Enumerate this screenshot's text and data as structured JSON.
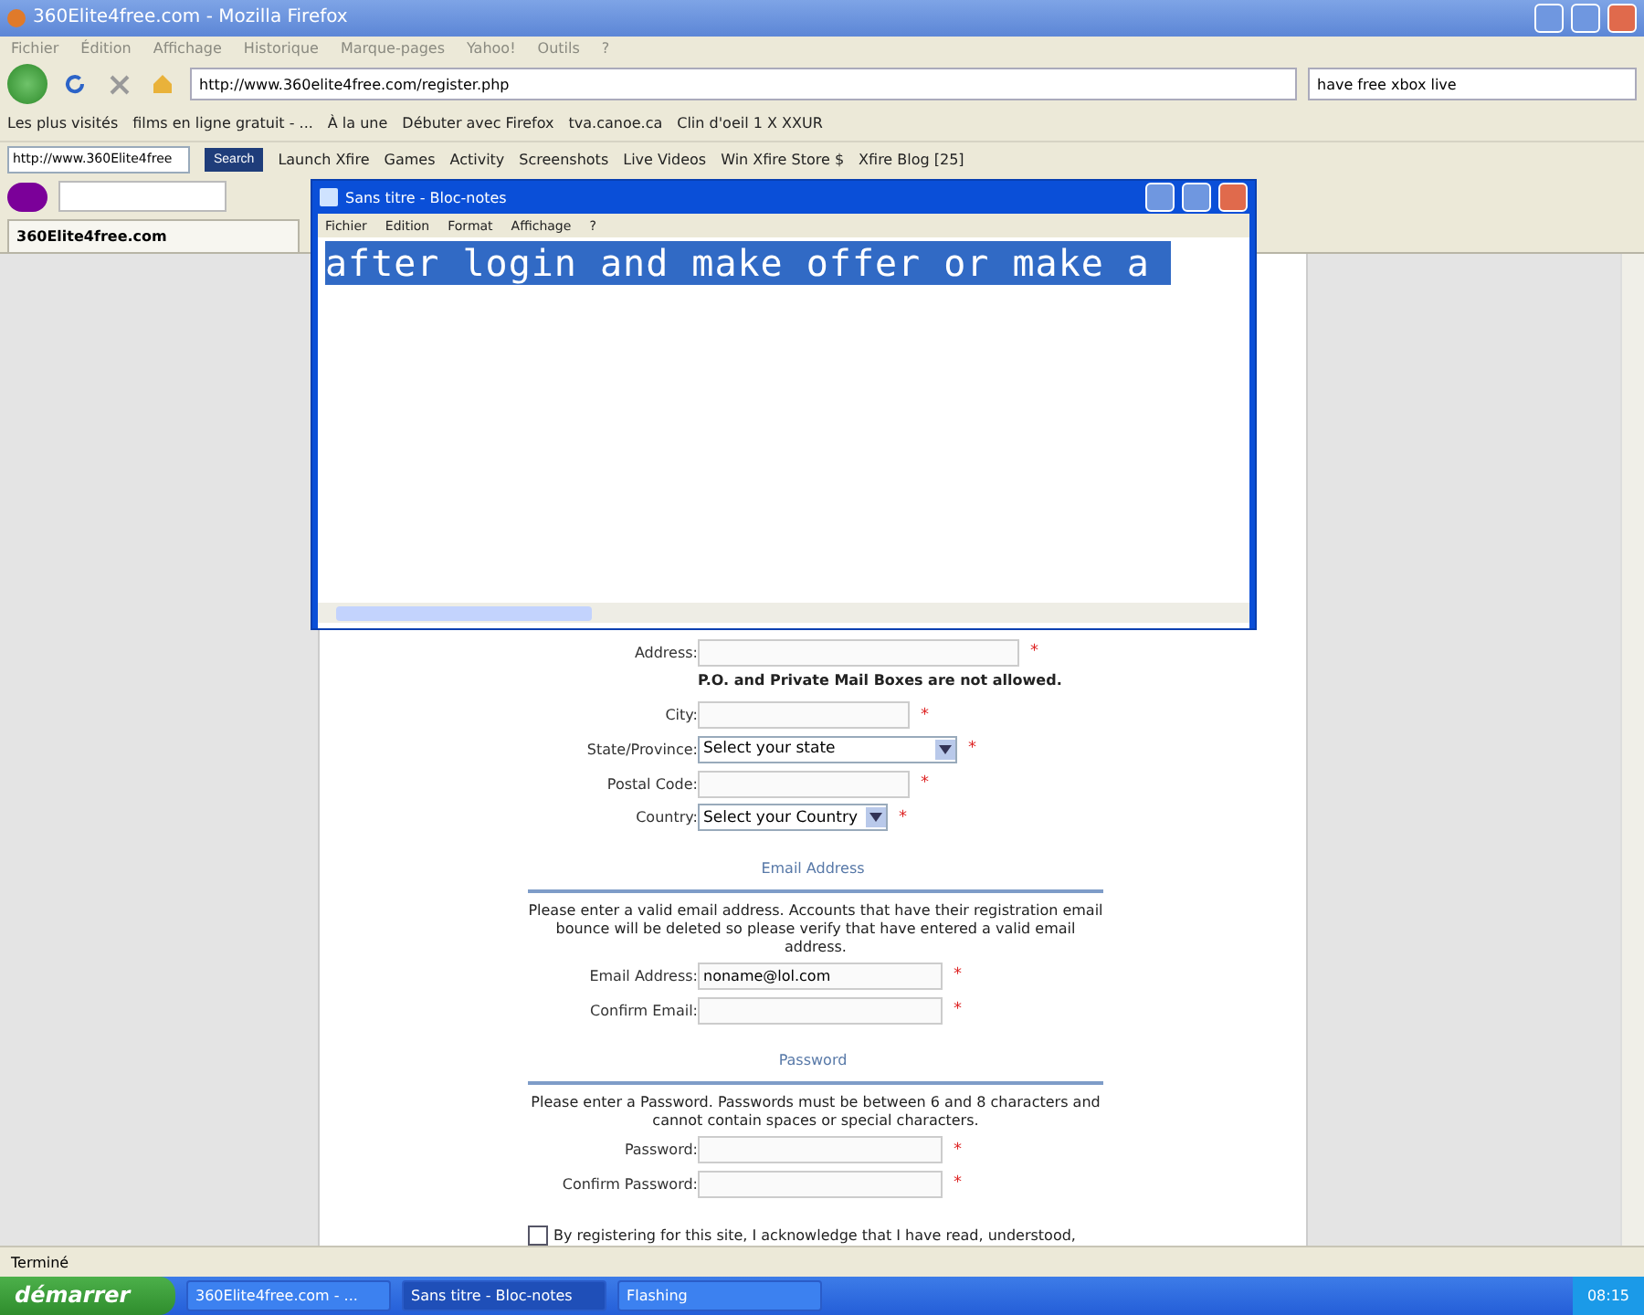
{
  "browser": {
    "title": "360Elite4free.com - Mozilla Firefox",
    "menu": [
      "Fichier",
      "Édition",
      "Affichage",
      "Historique",
      "Marque-pages",
      "Yahoo!",
      "Outils",
      "?"
    ],
    "url": "http://www.360elite4free.com/register.php",
    "search": "have free xbox live",
    "bookmarks": [
      "Les plus visités",
      "films en ligne gratuit - ...",
      "À la une",
      "Débuter avec Firefox",
      "tva.canoe.ca",
      "Clin d'oeil 1 X XXUR"
    ],
    "xfire": {
      "address": "http://www.360Elite4free",
      "search_button": "Search",
      "items": [
        "Launch Xfire",
        "Games",
        "Activity",
        "Screenshots",
        "Live Videos",
        "Win Xfire Store $",
        "Xfire Blog [25]"
      ]
    },
    "tab": "360Elite4free.com",
    "status": "Terminé"
  },
  "page": [
    {
      "kind": "input",
      "label": "Address:",
      "mark": "*"
    },
    {
      "kind": "note",
      "text": "P.O. and Private Mail Boxes are not allowed."
    },
    {
      "kind": "input",
      "label": "City:",
      "mark": "*"
    },
    {
      "kind": "select",
      "label": "State/Province:",
      "value": "Select your state",
      "mark": "*"
    },
    {
      "kind": "input",
      "label": "Postal Code:",
      "mark": "*"
    },
    {
      "kind": "select",
      "label": "Country:",
      "value": "Select your Country",
      "mark": "*"
    },
    {
      "kind": "heading",
      "text": "Email Address"
    },
    {
      "kind": "paragraph",
      "text": "Please enter a valid email address. Accounts that have their registration email bounce will be deleted so please verify that have entered a valid email address."
    },
    {
      "kind": "input",
      "label": "Email Address:",
      "value": "noname@lol.com",
      "mark": "*"
    },
    {
      "kind": "input",
      "label": "Confirm Email:",
      "mark": "*"
    },
    {
      "kind": "heading",
      "text": "Password"
    },
    {
      "kind": "paragraph",
      "text": "Please enter a Password. Passwords must be between 6 and 8 characters and cannot contain spaces or special characters."
    },
    {
      "kind": "input",
      "label": "Password:",
      "mark": "*"
    },
    {
      "kind": "input",
      "label": "Confirm Password:",
      "mark": "*"
    },
    {
      "kind": "checkbox",
      "text": "By registering for this site, I acknowledge that I have read, understood,",
      "checked": false
    }
  ],
  "notepad": {
    "title": "Sans titre - Bloc-notes",
    "menu": [
      "Fichier",
      "Edition",
      "Format",
      "Affichage",
      "?"
    ],
    "text": "after login and make offer or make a"
  },
  "taskbar": {
    "start": "démarrer",
    "tasks": [
      {
        "label": "360Elite4free.com - ...",
        "selected": false
      },
      {
        "label": "Sans titre - Bloc-notes",
        "selected": true
      },
      {
        "label": "Flashing",
        "selected": false
      }
    ],
    "clock": "08:15"
  }
}
